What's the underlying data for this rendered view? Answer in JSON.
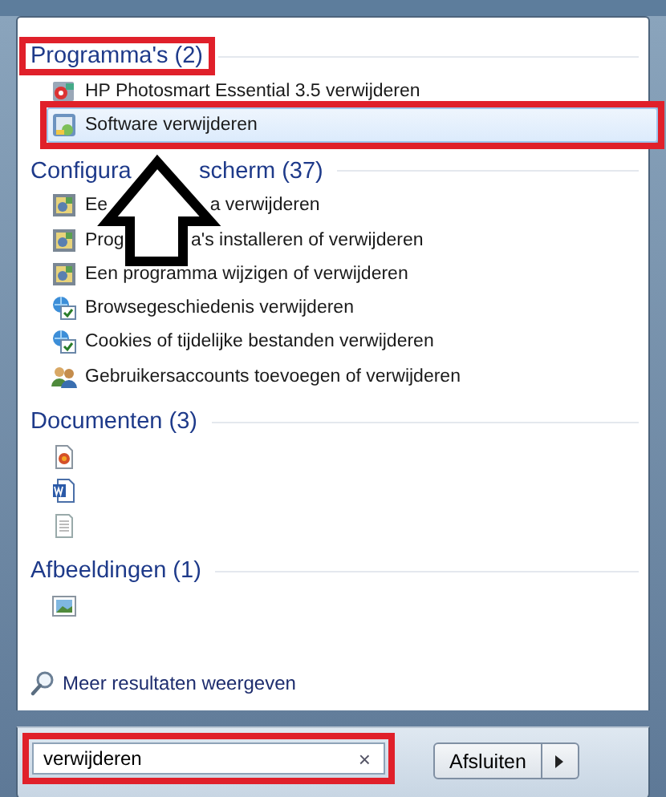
{
  "sections": [
    {
      "title_parts": [
        "Programma's (2)"
      ],
      "marked": true,
      "items": [
        {
          "kind": "program",
          "label_parts": [
            "HP Photosmart Essential 3.5 verwijderen"
          ],
          "selected": false,
          "marked": false
        },
        {
          "kind": "software",
          "label_parts": [
            "Software verwijderen"
          ],
          "selected": true,
          "marked": true
        }
      ]
    },
    {
      "title_parts": [
        "Configura",
        "scherm (37)"
      ],
      "marked": false,
      "items": [
        {
          "kind": "panel",
          "label_parts": [
            "Ee",
            "a verwijderen"
          ],
          "selected": false,
          "marked": false
        },
        {
          "kind": "panel",
          "label_parts": [
            "Prog",
            "a's installeren of verwijderen"
          ],
          "selected": false,
          "marked": false
        },
        {
          "kind": "panel",
          "label_parts": [
            "Een programma wijzigen of verwijderen"
          ],
          "selected": false,
          "marked": false
        },
        {
          "kind": "internet",
          "label_parts": [
            "Browsegeschiedenis verwijderen"
          ],
          "selected": false,
          "marked": false
        },
        {
          "kind": "internet",
          "label_parts": [
            "Cookies of tijdelijke bestanden verwijderen"
          ],
          "selected": false,
          "marked": false
        },
        {
          "kind": "users",
          "label_parts": [
            "Gebruikersaccounts toevoegen of verwijderen"
          ],
          "selected": false,
          "marked": false
        }
      ]
    },
    {
      "title_parts": [
        "Documenten (3)"
      ],
      "marked": false,
      "items": [
        {
          "kind": "pdf",
          "selected": false,
          "marked": false
        },
        {
          "kind": "word",
          "selected": false,
          "marked": false
        },
        {
          "kind": "text",
          "selected": false,
          "marked": false
        }
      ]
    },
    {
      "title_parts": [
        "Afbeeldingen (1)"
      ],
      "marked": false,
      "items": [
        {
          "kind": "image",
          "selected": false,
          "marked": false
        }
      ]
    }
  ],
  "more_results": "Meer resultaten weergeven",
  "search": {
    "value": "verwijderen",
    "marked": true,
    "clear": "×"
  },
  "shutdown_button": "Afsluiten"
}
